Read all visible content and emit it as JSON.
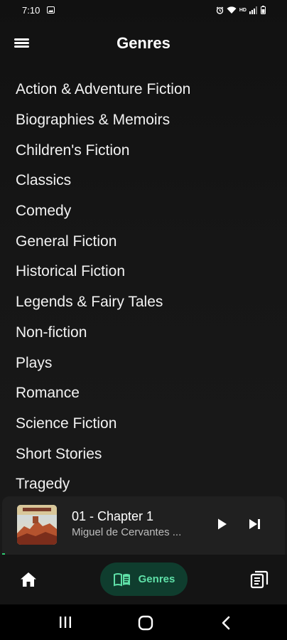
{
  "status_bar": {
    "time": "7:10",
    "network_label": "HD"
  },
  "header": {
    "title": "Genres"
  },
  "genres": [
    "Action & Adventure Fiction",
    "Biographies & Memoirs",
    "Children's Fiction",
    "Classics",
    "Comedy",
    "General Fiction",
    "Historical Fiction",
    "Legends & Fairy Tales",
    "Non-fiction",
    "Plays",
    "Romance",
    "Science Fiction",
    "Short Stories",
    "Tragedy"
  ],
  "mini_player": {
    "title": "01 - Chapter 1",
    "author": "Miguel de Cervantes ...",
    "progress": 0.01
  },
  "bottom_nav": {
    "active_label": "Genres",
    "items": [
      "home-icon",
      "genres-icon",
      "library-icon"
    ]
  },
  "colors": {
    "background": "#111111",
    "accent": "#5fe0a8",
    "active_pill": "#0f3d2e",
    "player_bg": "#202020",
    "progress": "#2ecc71"
  }
}
